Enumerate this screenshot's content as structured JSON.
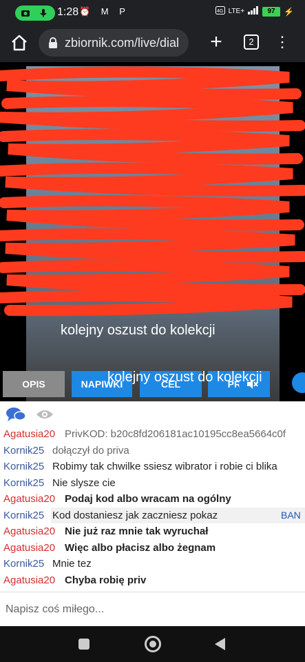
{
  "status": {
    "time": "1:28",
    "notif_icons": "⏰ M P",
    "network": "LTE+",
    "battery": "97"
  },
  "browser": {
    "url": "zbiornik.com/live/dial",
    "tab_count": "2"
  },
  "video": {
    "overlay_messages": [
      "kolejny oszust do kolekcji",
      "kolejny oszust do kolekcji"
    ],
    "buttons": {
      "opis": "OPIS",
      "napiwki": "NAPIWKI",
      "cel": "CEL",
      "priv": "PRIV"
    }
  },
  "chat": {
    "messages": [
      {
        "nick": "Agatusia20",
        "text": "PrivKOD: b20c8fd206181ac10195cc8ea5664c0f",
        "nick_color": "red",
        "style": "grey"
      },
      {
        "nick": "Kornik25",
        "text": "dołączył do priva",
        "nick_color": "blue",
        "style": "grey"
      },
      {
        "nick": "Kornik25",
        "text": "Robimy tak chwilke ssiesz wibrator i robie ci blika",
        "nick_color": "blue",
        "style": "plain"
      },
      {
        "nick": "Kornik25",
        "text": "Nie slysze cie",
        "nick_color": "blue",
        "style": "plain"
      },
      {
        "nick": "Agatusia20",
        "text": "Podaj kod albo wracam na ogólny",
        "nick_color": "red",
        "style": "bold"
      },
      {
        "nick": "Kornik25",
        "text": "Kod dostaniesz jak zaczniesz pokaz",
        "nick_color": "blue",
        "style": "plain",
        "ban": "BAN"
      },
      {
        "nick": "Agatusia20",
        "text": "Nie już raz mnie tak wyruchał",
        "nick_color": "red",
        "style": "bold"
      },
      {
        "nick": "Agatusia20",
        "text": "Więc albo płacisz albo żegnam",
        "nick_color": "red",
        "style": "bold"
      },
      {
        "nick": "Kornik25",
        "text": "Mnie tez",
        "nick_color": "blue",
        "style": "plain"
      },
      {
        "nick": "Agatusia20",
        "text": "Chyba robię priv",
        "nick_color": "red",
        "style": "bold"
      }
    ],
    "input_placeholder": "Napisz coś miłego..."
  },
  "colors": {
    "accent": "#1e88e5",
    "nick_red": "#d32f2f",
    "nick_blue": "#3b5998",
    "redaction": "#ff3b1f"
  }
}
